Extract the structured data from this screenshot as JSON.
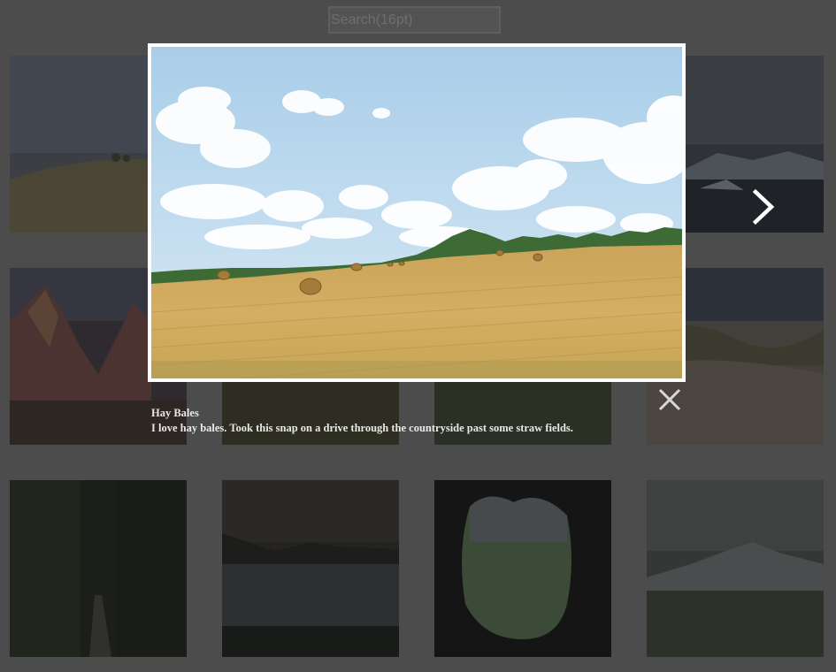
{
  "search": {
    "placeholder": "Search(16pt)"
  },
  "gallery": {
    "thumbnails": [
      {
        "name": "hay-field-thumb"
      },
      {
        "name": "iceberg-lake-thumb"
      },
      {
        "name": "red-rock-canyon-thumb"
      },
      {
        "name": "forest-thumb"
      },
      {
        "name": "meadow-thumb"
      },
      {
        "name": "sand-dunes-thumb"
      },
      {
        "name": "forest-path-thumb"
      },
      {
        "name": "coastline-dusk-thumb"
      },
      {
        "name": "cave-opening-thumb"
      },
      {
        "name": "snowy-mountain-field-thumb"
      }
    ]
  },
  "lightbox": {
    "title": "Hay Bales",
    "description": "I love hay bales. Took this snap on a drive through the countryside past some straw fields.",
    "close_icon": "close-icon",
    "next_icon": "chevron-right-icon"
  },
  "colors": {
    "overlay_dim": "#4c4c4c",
    "frame": "#ffffff",
    "caption_text": "#e8e8e8"
  }
}
